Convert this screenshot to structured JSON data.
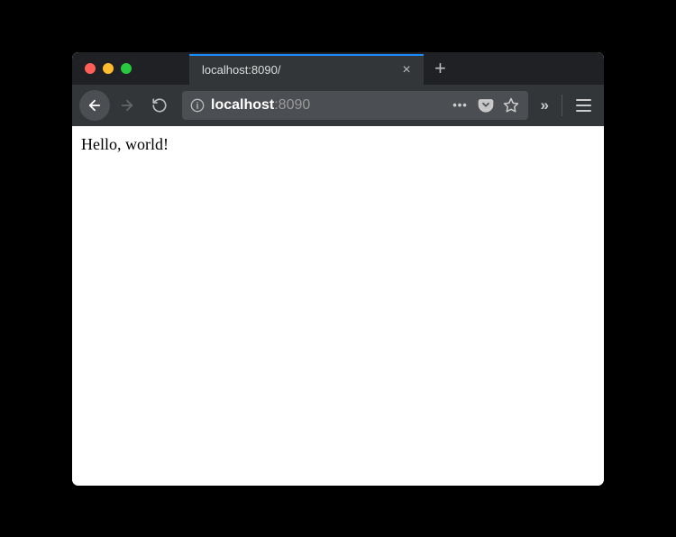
{
  "traffic_lights": {
    "close": "#ff5f57",
    "min": "#febc2e",
    "max": "#28c840"
  },
  "tab": {
    "title": "localhost:8090/"
  },
  "url": {
    "host": "localhost",
    "port": ":8090"
  },
  "page": {
    "body_text": "Hello, world!"
  }
}
